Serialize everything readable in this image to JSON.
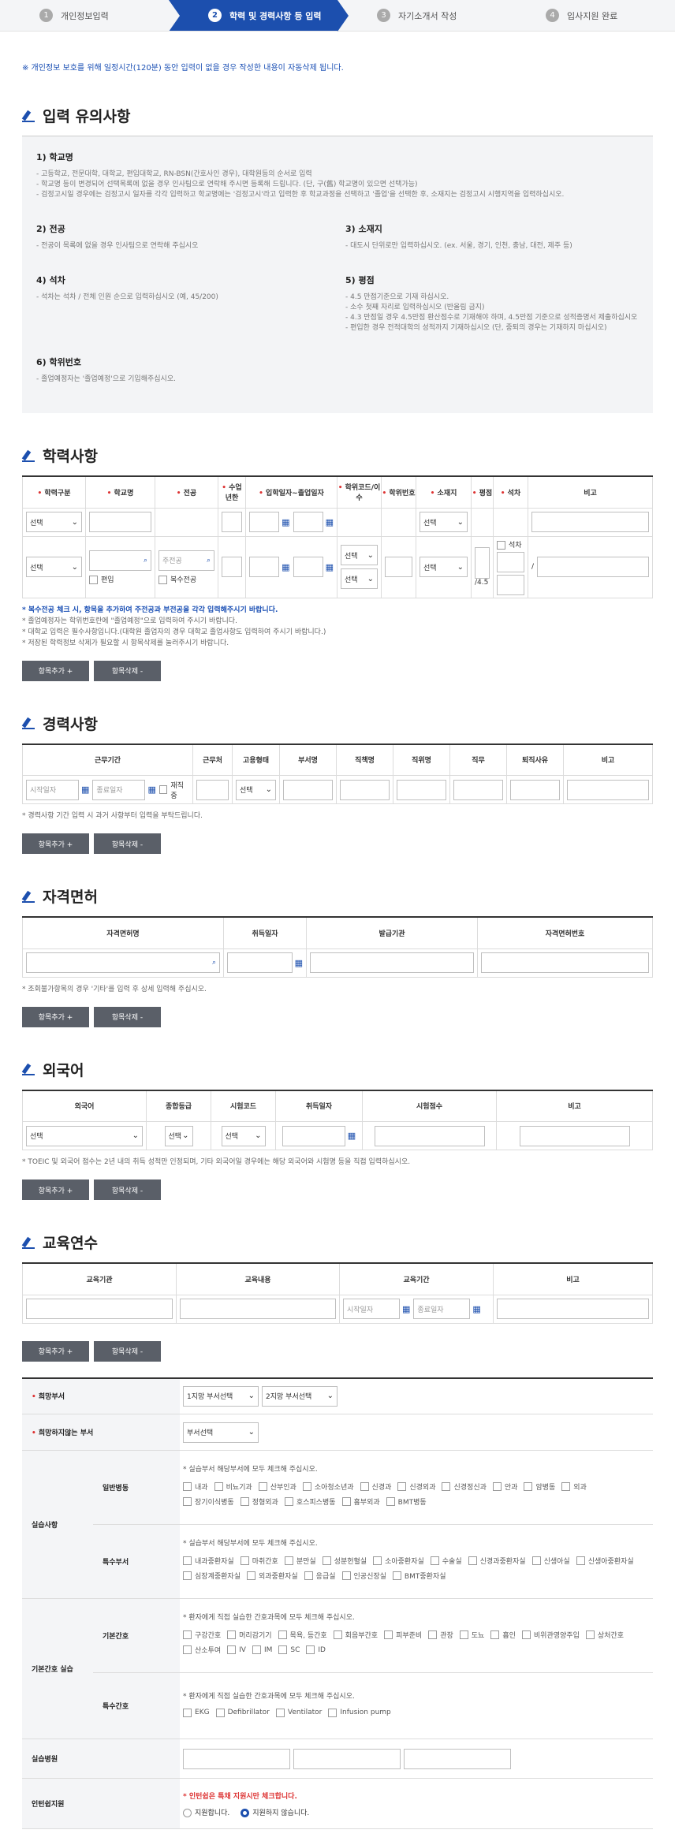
{
  "steps": [
    {
      "num": "1",
      "label": "개인정보입력"
    },
    {
      "num": "2",
      "label": "학력 및 경력사항 등 입력"
    },
    {
      "num": "3",
      "label": "자기소개서 작성"
    },
    {
      "num": "4",
      "label": "입사지원 완료"
    }
  ],
  "notice": "※ 개인정보 보호를 위해 일정시간(120분) 동안 입력이 없을 경우 작성한 내용이 자동삭제 됩니다.",
  "guide": {
    "title": "입력 유의사항",
    "items": [
      {
        "h": "1) 학교명",
        "lines": [
          "- 고등학교, 전문대학, 대학교, 편입대학교, RN-BSN(간호사인 경우), 대학원등의 순서로 입력",
          "- 학교명 등이 변경되어 선택목록에 없을 경우 인사팀으로 연락해 주시면 등록해 드립니다. (단, 구(舊) 학교명이 있으면 선택가능)",
          "- 검정고시일 경우에는 검정고시 일자를 각각 입력하고 학교명에는 '검정고시'라고 입력한 후 학교과정을 선택하고 '졸업'을 선택한 후, 소재지는 검정고시 시행지역을 입력하십시오."
        ]
      },
      {
        "h": "2) 전공",
        "lines": [
          "- 전공이 목록에 없을 경우 인사팀으로 연락해 주십시오"
        ]
      },
      {
        "h": "3) 소재지",
        "lines": [
          "- 대도시 단위로만 입력하십시오. (ex. 서울, 경기, 인천, 충남, 대전, 제주 등)"
        ]
      },
      {
        "h": "4) 석차",
        "lines": [
          "- 석차는 석차 / 전체 인원 순으로 입력하십시오 (예, 45/200)"
        ]
      },
      {
        "h": "5) 평점",
        "lines": [
          "- 4.5 만점기준으로 기재 하십시오.",
          "- 소수 첫째 자리로 입력하십시오 (반올림 금지)",
          "- 4.3 만점일 경우 4.5만점 환산점수로 기재해야 하며, 4.5만점 기준으로 성적증명서 제출하십시오",
          "- 편입한 경우 전적대학의 성적까지 기재하십시오 (단, 중퇴의 경우는 기재하지 마십시오)"
        ]
      },
      {
        "h": "6) 학위번호",
        "lines": [
          "- 졸업예정자는 '졸업예정'으로 기입해주십시오."
        ]
      }
    ]
  },
  "education": {
    "title": "학력사항",
    "headers": [
      "학력구분",
      "학교명",
      "전공",
      "수업 년한",
      "입학일자~졸업일자",
      "학위코드/이수",
      "학위번호",
      "소재지",
      "평점",
      "석차",
      "비고"
    ],
    "select": "선택",
    "major_ph": "주전공",
    "transfer": "편입",
    "double": "복수전공",
    "gpa_max": "/4.5",
    "rank_label": "석차",
    "slash": "/",
    "notes": [
      {
        "t": "* 복수전공 체크 시, 항목을 추가하여 주전공과 부전공을 각각 입력해주시기 바랍니다.",
        "blue": true
      },
      {
        "t": "* 졸업예정자는 학위번호란에 \"졸업예정\"으로 입력하여 주시기 바랍니다."
      },
      {
        "t": "* 대학교 입력은 필수사항입니다.(대학원 졸업자의 경우 대학교 졸업사항도 입력하여 주시기 바랍니다.)"
      },
      {
        "t": "* 저장된 학력정보 삭제가 필요할 시 항목삭제를 눌러주시기 바랍니다."
      }
    ]
  },
  "buttons": {
    "add": "항목추가 +",
    "del": "항목삭제 -"
  },
  "career": {
    "title": "경력사항",
    "headers": [
      "근무기간",
      "근무처",
      "고용형태",
      "부서명",
      "직책명",
      "직위명",
      "직무",
      "퇴직사유",
      "비고"
    ],
    "start": "시작일자",
    "end": "종료일자",
    "current": "재직중",
    "select": "선택",
    "note": "* 경력사항 기간 입력 시 과거 사항부터 입력을 부탁드립니다."
  },
  "license": {
    "title": "자격면허",
    "headers": [
      "자격면허명",
      "취득일자",
      "발급기관",
      "자격면허번호"
    ],
    "note": "* 조회불가항목의 경우 '기타'를 입력 후 상세 입력해 주십시오."
  },
  "lang": {
    "title": "외국어",
    "headers": [
      "외국어",
      "종합등급",
      "시험코드",
      "취득일자",
      "시험점수",
      "비고"
    ],
    "select": "선택",
    "note": "* TOEIC 및 외국어 점수는 2년 내의 취득 성적만 인정되며, 기타 외국어일 경우에는 해당 외국어와 시험명 등을 직접 입력하십시오."
  },
  "training": {
    "title": "교육연수",
    "headers": [
      "교육기관",
      "교육내용",
      "교육기간",
      "비고"
    ],
    "start": "시작일자",
    "end": "종료일자"
  },
  "bottom": {
    "hope": "희망부서",
    "hope1": "1지망 부서선택",
    "hope2": "2지망 부서선택",
    "nohope": "희망하지않는 부서",
    "dept": "부서선택",
    "practice": "실습사항",
    "general": "일반병동",
    "special": "특수부서",
    "check_note": "* 실습부서 해당부서에 모두 체크해 주십시오.",
    "general_items": [
      "내과",
      "비뇨기과",
      "산부인과",
      "소아청소년과",
      "신경과",
      "신경외과",
      "신경정신과",
      "안과",
      "암병동",
      "외과",
      "장기이식병동",
      "정형외과",
      "호스피스병동",
      "흉부외과",
      "BMT병동"
    ],
    "special_items": [
      "내과중환자실",
      "마취간호",
      "분만실",
      "성분헌혈실",
      "소아중환자실",
      "수술실",
      "신경과중환자실",
      "신생아실",
      "신생아중환자실",
      "심장계중환자실",
      "외과중환자실",
      "응급실",
      "인공신장실",
      "BMT중환자실"
    ],
    "basic_title": "기본간호 실습",
    "basic": "기본간호",
    "basic_note": "* 환자에게 직접 실습한 간호과목에 모두 체크해 주십시오.",
    "basic_items": [
      "구강간호",
      "머리감기기",
      "목욕, 등간호",
      "회음부간호",
      "피부준비",
      "관장",
      "도뇨",
      "흡인",
      "비위관영양주입",
      "상처간호",
      "산소투여",
      "IV",
      "IM",
      "SC",
      "ID"
    ],
    "special_care": "특수간호",
    "special_care_items": [
      "EKG",
      "Defibrillator",
      "Ventilator",
      "Infusion pump"
    ],
    "hospital": "실습병원",
    "intern": "인턴쉽지원",
    "intern_note": "* 인턴쉽은 특채 지원시만 체크합니다.",
    "yes": "지원합니다.",
    "no": "지원하지 않습니다."
  }
}
